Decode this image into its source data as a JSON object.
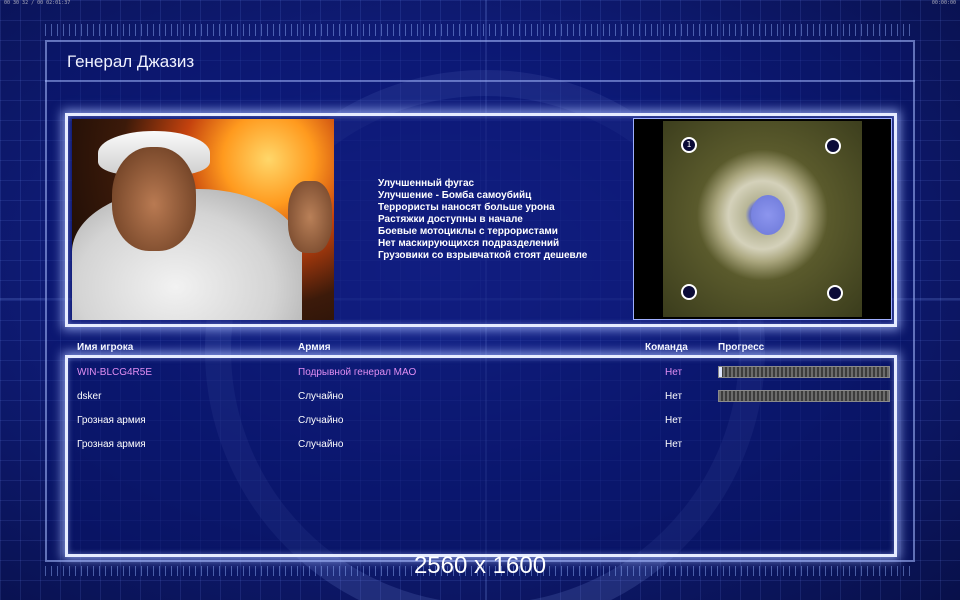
{
  "system_bar": {
    "left_text": "00 30 32 / 00 02:01:37",
    "right_text": "00:00:00"
  },
  "title": "Генерал Джазиз",
  "general": {
    "bonuses": [
      "Улучшенный фугас",
      "Улучшение - Бомба самоубийц",
      "Террористы наносят больше урона",
      "Растяжки доступны в начале",
      "Боевые мотоциклы с террористами",
      "Нет маскирующихся подразделений",
      "Грузовики со взрывчаткой стоят дешевле"
    ]
  },
  "map": {
    "start_positions": [
      {
        "label": "1"
      },
      {
        "label": ""
      },
      {
        "label": ""
      },
      {
        "label": ""
      }
    ]
  },
  "table": {
    "headers": {
      "player": "Имя игрока",
      "army": "Армия",
      "team": "Команда",
      "progress": "Прогресс"
    },
    "rows": [
      {
        "player": "WIN-BLCG4R5E",
        "army": "Подрывной генерал МАО",
        "team": "Нет",
        "progress": 0.01,
        "local": true,
        "show_progress": true
      },
      {
        "player": "dsker",
        "army": "Случайно",
        "team": "Нет",
        "progress": 0.0,
        "local": false,
        "show_progress": true
      },
      {
        "player": "Грозная армия",
        "army": "Случайно",
        "team": "Нет",
        "local": false,
        "show_progress": false
      },
      {
        "player": "Грозная армия",
        "army": "Случайно",
        "team": "Нет",
        "local": false,
        "show_progress": false
      }
    ]
  },
  "watermark": "2560 x 1600",
  "colors": {
    "local_player": "#e08ef2",
    "panel_border": "#e6ecff",
    "background": "#0f1c7a"
  }
}
